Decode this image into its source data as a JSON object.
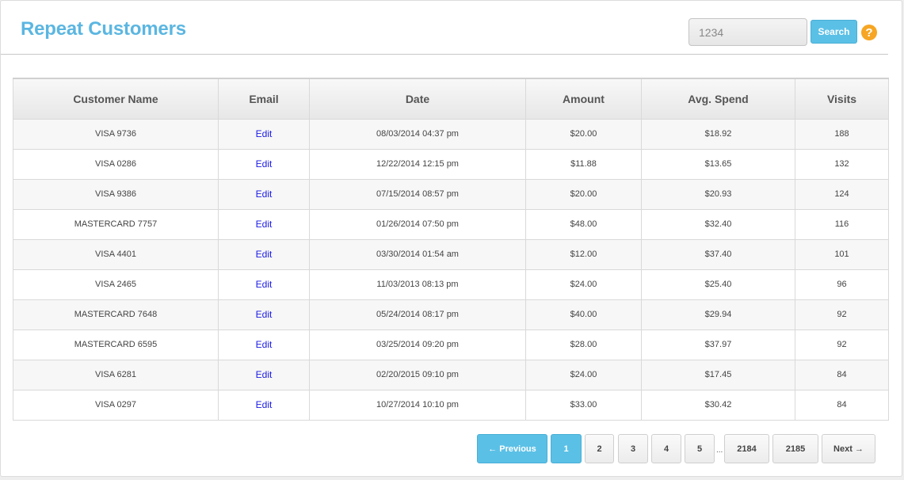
{
  "header": {
    "title": "Repeat Customers",
    "search_value": "1234",
    "search_button": "Search",
    "help": "?"
  },
  "table": {
    "columns": [
      "Customer Name",
      "Email",
      "Date",
      "Amount",
      "Avg. Spend",
      "Visits"
    ],
    "rows": [
      {
        "name": "VISA 9736",
        "email": "Edit",
        "date": "08/03/2014 04:37 pm",
        "amount": "$20.00",
        "avg": "$18.92",
        "visits": "188"
      },
      {
        "name": "VISA 0286",
        "email": "Edit",
        "date": "12/22/2014 12:15 pm",
        "amount": "$11.88",
        "avg": "$13.65",
        "visits": "132"
      },
      {
        "name": "VISA 9386",
        "email": "Edit",
        "date": "07/15/2014 08:57 pm",
        "amount": "$20.00",
        "avg": "$20.93",
        "visits": "124"
      },
      {
        "name": "MASTERCARD 7757",
        "email": "Edit",
        "date": "01/26/2014 07:50 pm",
        "amount": "$48.00",
        "avg": "$32.40",
        "visits": "116"
      },
      {
        "name": "VISA 4401",
        "email": "Edit",
        "date": "03/30/2014 01:54 am",
        "amount": "$12.00",
        "avg": "$37.40",
        "visits": "101"
      },
      {
        "name": "VISA 2465",
        "email": "Edit",
        "date": "11/03/2013 08:13 pm",
        "amount": "$24.00",
        "avg": "$25.40",
        "visits": "96"
      },
      {
        "name": "MASTERCARD 7648",
        "email": "Edit",
        "date": "05/24/2014 08:17 pm",
        "amount": "$40.00",
        "avg": "$29.94",
        "visits": "92"
      },
      {
        "name": "MASTERCARD 6595",
        "email": "Edit",
        "date": "03/25/2014 09:20 pm",
        "amount": "$28.00",
        "avg": "$37.97",
        "visits": "92"
      },
      {
        "name": "VISA 6281",
        "email": "Edit",
        "date": "02/20/2015 09:10 pm",
        "amount": "$24.00",
        "avg": "$17.45",
        "visits": "84"
      },
      {
        "name": "VISA 0297",
        "email": "Edit",
        "date": "10/27/2014 10:10 pm",
        "amount": "$33.00",
        "avg": "$30.42",
        "visits": "84"
      }
    ]
  },
  "pagination": {
    "previous": "← Previous",
    "pages": [
      "1",
      "2",
      "3",
      "4",
      "5"
    ],
    "ellipsis": "...",
    "last_pages": [
      "2184",
      "2185"
    ],
    "next": "Next →",
    "current": "1"
  },
  "colors": {
    "accent": "#5bc0e6",
    "title": "#5bb6e1",
    "help": "#f6a623",
    "link": "#1a1ae6"
  }
}
